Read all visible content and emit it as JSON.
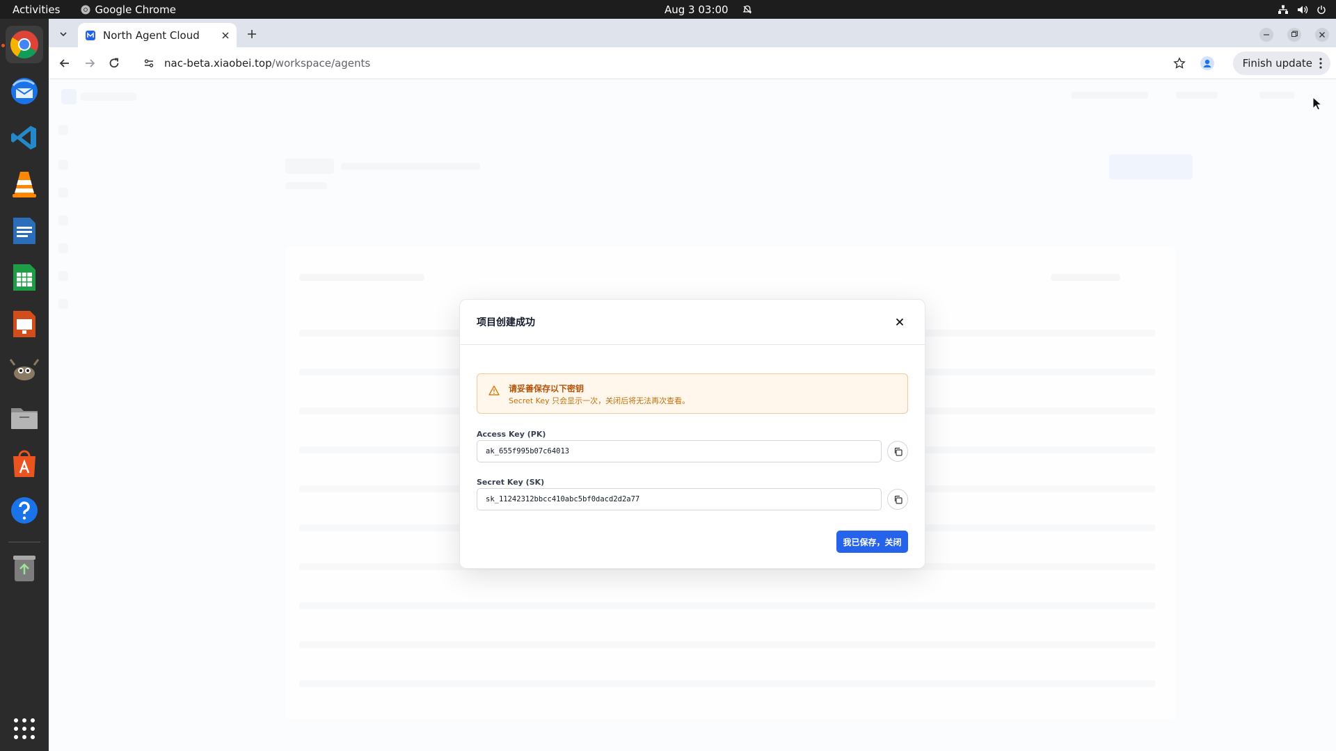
{
  "topbar": {
    "activities": "Activities",
    "app_name": "Google Chrome",
    "date_time": "Aug 3  03:00"
  },
  "dock": {
    "apps": [
      "chrome-icon",
      "thunderbird-icon",
      "vscode-icon",
      "vlc-icon",
      "writer-icon",
      "calc-icon",
      "impress-icon",
      "gimp-icon",
      "files-icon",
      "app-center-icon",
      "help-icon",
      "trash-icon",
      "app-grid-icon"
    ]
  },
  "browser": {
    "tab_title": "North Agent Cloud",
    "url_host": "nac-beta.xiaobei.top",
    "url_path": "/workspace/agents",
    "finish_update": "Finish update"
  },
  "modal": {
    "title": "项目创建成功",
    "alert_title": "请妥善保存以下密钥",
    "alert_desc": "Secret Key 只会显示一次，关闭后将无法再次查看。",
    "ak_label": "Access Key (PK)",
    "ak_value": "ak_655f995b07c64013",
    "sk_label": "Secret Key (SK)",
    "sk_value": "sk_11242312bbcc410abc5bf0dacd2d2a77",
    "confirm_button": "我已保存，关闭"
  },
  "colors": {
    "primary": "#2563eb",
    "warning_bg": "#fff6ec",
    "warning_text": "#b45309"
  }
}
